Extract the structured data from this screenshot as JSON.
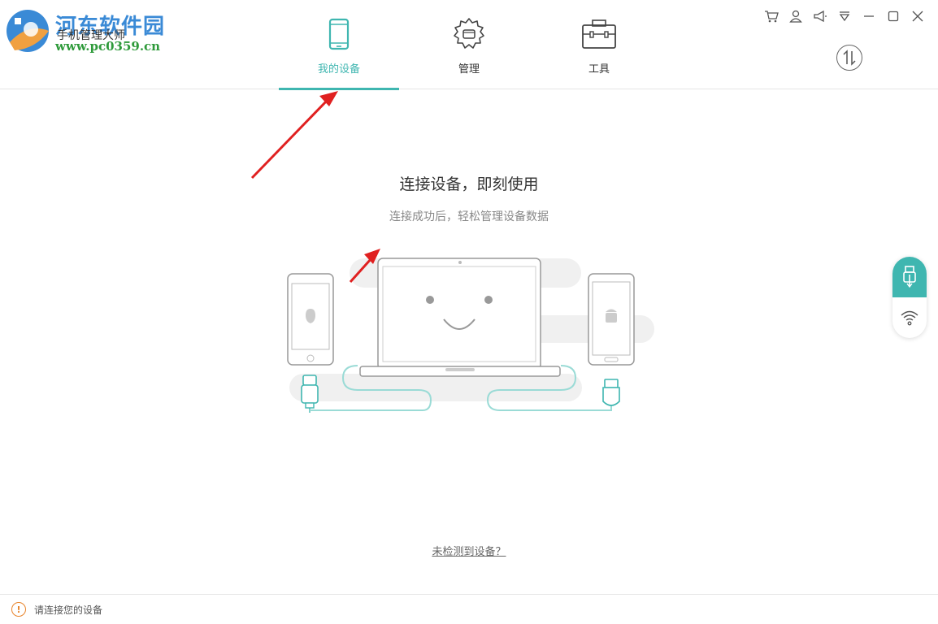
{
  "header": {
    "brand_name": "河东软件园",
    "app_title": "手机管理大师",
    "brand_url": "www.pc0359.cn",
    "tabs": [
      {
        "label": "我的设备",
        "icon": "phone-icon",
        "active": true
      },
      {
        "label": "管理",
        "icon": "gear-icon",
        "active": false
      },
      {
        "label": "工具",
        "icon": "toolbox-icon",
        "active": false
      }
    ],
    "window_controls": [
      "cart-icon",
      "user-icon",
      "megaphone-icon",
      "menu-icon",
      "minimize-icon",
      "maximize-icon",
      "close-icon"
    ]
  },
  "main": {
    "title": "连接设备，即刻使用",
    "subtitle": "连接成功后，轻松管理设备数据",
    "no_device_link": "未检测到设备？"
  },
  "side_toggle": {
    "usb": "usb-icon",
    "wifi": "wifi-icon"
  },
  "status": {
    "icon_glyph": "!",
    "text": "请连接您的设备"
  },
  "colors": {
    "accent": "#3fb6b0",
    "brand_blue": "#3a8ad6",
    "brand_green": "#2e9a3a",
    "warning": "#e8842b",
    "arrow_red": "#e02020"
  }
}
